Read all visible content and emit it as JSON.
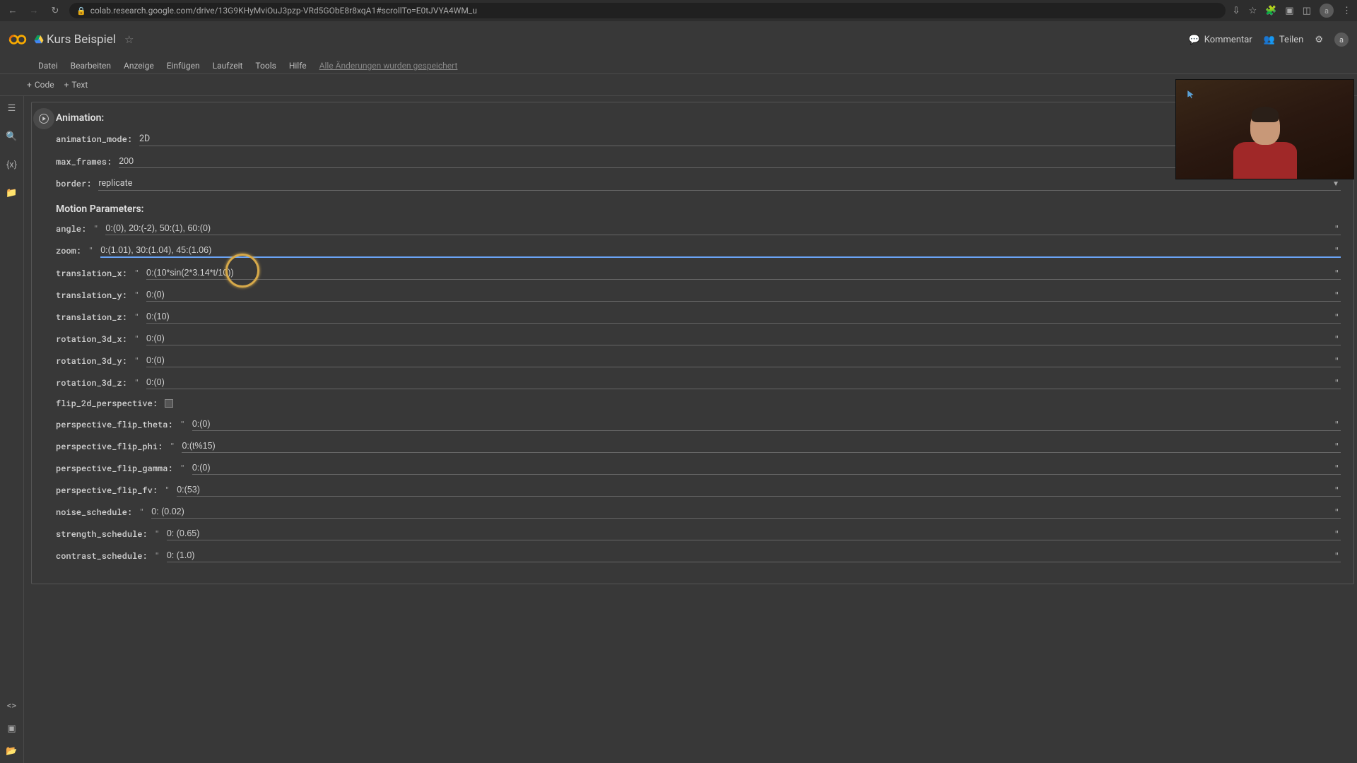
{
  "url": "colab.research.google.com/drive/13G9KHyMviOuJ3pzp-VRd5GObE8r8xqA1#scrollTo=E0tJVYA4WM_u",
  "doc_title": "Kurs Beispiel",
  "avatar_letter": "a",
  "header": {
    "kommentar": "Kommentar",
    "teilen": "Teilen"
  },
  "menu": {
    "datei": "Datei",
    "bearbeiten": "Bearbeiten",
    "anzeige": "Anzeige",
    "einfugen": "Einfügen",
    "laufzeit": "Laufzeit",
    "tools": "Tools",
    "hilfe": "Hilfe",
    "autosave": "Alle Änderungen wurden gespeichert"
  },
  "toolbar": {
    "code": "Code",
    "text": "Text"
  },
  "cell": {
    "section1": "Animation:",
    "section2": "Motion Parameters:",
    "params": {
      "animation_mode": {
        "label": "animation_mode:",
        "value": "2D"
      },
      "max_frames": {
        "label": "max_frames:",
        "value": "200"
      },
      "border": {
        "label": "border:",
        "value": "replicate"
      },
      "angle": {
        "label": "angle:",
        "value": "0:(0), 20:(-2), 50:(1), 60:(0)"
      },
      "zoom": {
        "label": "zoom:",
        "value": "0:(1.01), 30:(1.04), 45:(1.06)"
      },
      "translation_x": {
        "label": "translation_x:",
        "value": "0:(10*sin(2*3.14*t/10))"
      },
      "translation_y": {
        "label": "translation_y:",
        "value": "0:(0)"
      },
      "translation_z": {
        "label": "translation_z:",
        "value": "0:(10)"
      },
      "rotation_3d_x": {
        "label": "rotation_3d_x:",
        "value": "0:(0)"
      },
      "rotation_3d_y": {
        "label": "rotation_3d_y:",
        "value": "0:(0)"
      },
      "rotation_3d_z": {
        "label": "rotation_3d_z:",
        "value": "0:(0)"
      },
      "flip_2d_perspective": {
        "label": "flip_2d_perspective:"
      },
      "perspective_flip_theta": {
        "label": "perspective_flip_theta:",
        "value": "0:(0)"
      },
      "perspective_flip_phi": {
        "label": "perspective_flip_phi:",
        "value": "0:(t%15)"
      },
      "perspective_flip_gamma": {
        "label": "perspective_flip_gamma:",
        "value": "0:(0)"
      },
      "perspective_flip_fv": {
        "label": "perspective_flip_fv:",
        "value": "0:(53)"
      },
      "noise_schedule": {
        "label": "noise_schedule:",
        "value": "0: (0.02)"
      },
      "strength_schedule": {
        "label": "strength_schedule:",
        "value": "0: (0.65)"
      },
      "contrast_schedule": {
        "label": "contrast_schedule:",
        "value": "0: (1.0)"
      }
    }
  }
}
